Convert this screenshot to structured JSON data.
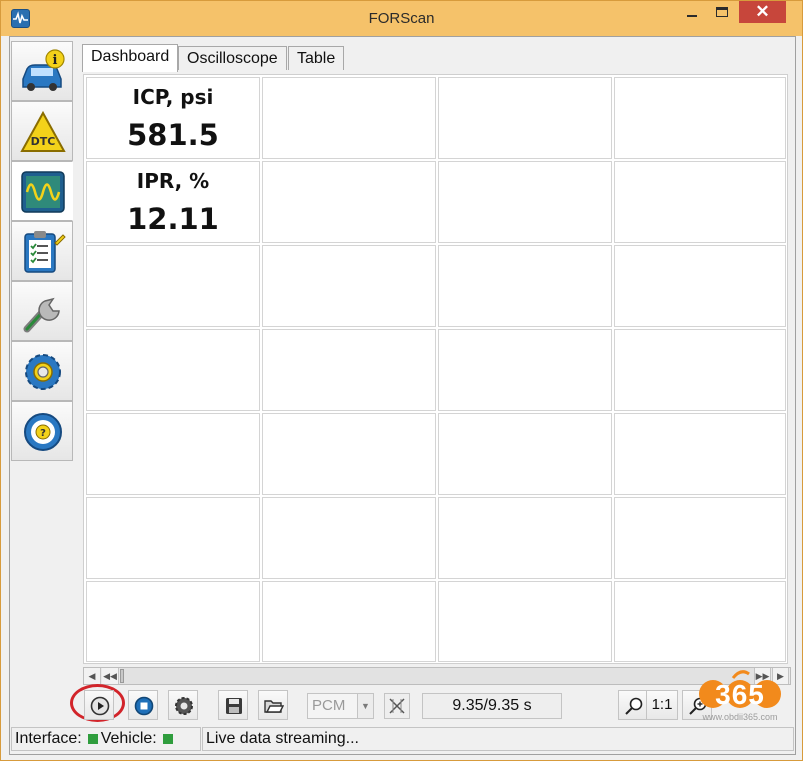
{
  "window": {
    "title": "FORScan",
    "close_glyph": "✕",
    "colors": {
      "title_bar": "#f5c26a",
      "close_button": "#c7463b",
      "highlight": "#d2242a",
      "status_led": "#2f9d3d"
    }
  },
  "sidebar": {
    "items": [
      {
        "icon": "vehicle-info-icon"
      },
      {
        "icon": "dtc-icon",
        "text": "DTC"
      },
      {
        "icon": "oscilloscope-icon",
        "active": true
      },
      {
        "icon": "checklist-icon"
      },
      {
        "icon": "wrench-icon"
      },
      {
        "icon": "gear-icon"
      },
      {
        "icon": "help-wheel-icon",
        "text": "?"
      }
    ]
  },
  "tabs": [
    {
      "label": "Dashboard",
      "active": true
    },
    {
      "label": "Oscilloscope"
    },
    {
      "label": "Table"
    }
  ],
  "dashboard": {
    "gauges": [
      {
        "label": "ICP, psi",
        "value": "581.5"
      },
      {
        "label": "IPR, %",
        "value": "12.11"
      }
    ],
    "rows": 7,
    "columns": 4
  },
  "toolbar": {
    "module_select": "PCM",
    "time_display": "9.35/9.35 s",
    "zoom_ratio": "1:1",
    "icons": [
      "play-icon",
      "stop-icon",
      "settings-gear-icon",
      "save-icon",
      "open-folder-icon",
      "clear-icon",
      "zoom-icon",
      "zoom-in-icon"
    ]
  },
  "statusbar": {
    "interface_label": "Interface:",
    "vehicle_label": "Vehicle:",
    "message": "Live data streaming..."
  },
  "watermark": {
    "text": "365",
    "url": "www.obdii365.com"
  }
}
